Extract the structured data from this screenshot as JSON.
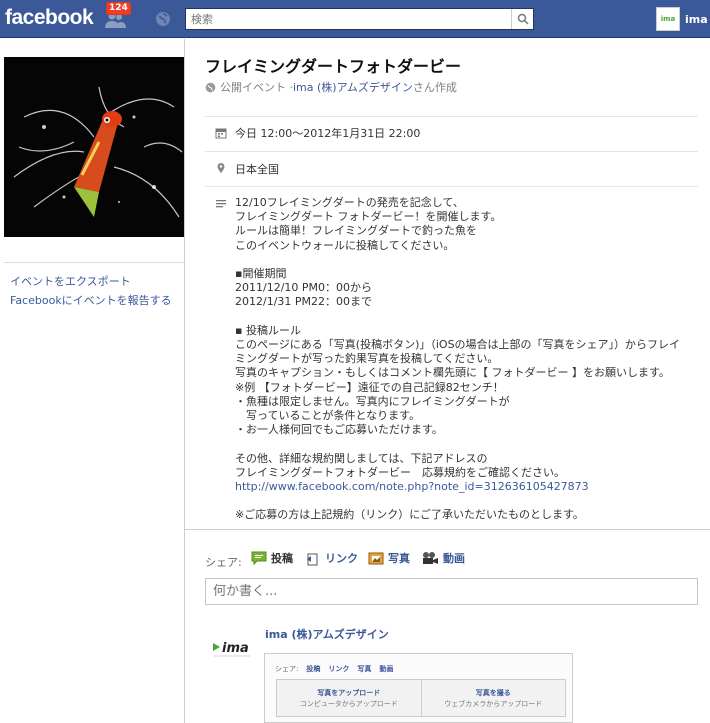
{
  "header": {
    "logo": "facebook",
    "notification_count": "124",
    "search_placeholder": "検索",
    "user_name": "ima",
    "user_avatar_text": "ima"
  },
  "sidebar": {
    "links": [
      "イベントをエクスポート",
      "Facebookにイベントを報告する"
    ]
  },
  "event": {
    "title": "フレイミングダートフォトダービー",
    "visibility": "公開イベント · ",
    "creator": "ima (株)アムズデザイン",
    "creator_suffix": "さん作成",
    "datetime": "今日 12:00～2012年1月31日 22:00",
    "location": "日本全国",
    "description_lines": [
      "12/10フレイミングダートの発売を記念して、",
      "フレイミングダート フォトダービー！を開催します。",
      "ルールは簡単！フレイミングダートで釣った魚を",
      "このイベントウォールに投稿してください。",
      "",
      "▪開催期間",
      "2011/12/10 PM0：00から",
      "2012/1/31 PM22：00まで",
      "",
      "▪ 投稿ルール",
      "このページにある「写真(投稿ボタン)」（iOSの場合は上部の「写真をシェア」）からフレイ",
      "ミングダートが写った釣果写真を投稿してください。",
      "写真のキャプション・もしくはコメント欄先頭に【 フォトダービー 】をお願いします。",
      "※例 【フォトダービー】遠征での自己記録82センチ！",
      "・魚種は限定しません。写真内にフレイミングダートが",
      "　写っていることが条件となります。",
      "・お一人様何回でもご応募いただけます。",
      "",
      "その他、詳細な規約関しましては、下記アドレスの",
      "フレイミングダートフォトダービー　応募規約をご確認ください。"
    ],
    "description_link": "http://www.facebook.com/note.php?note_id=312636105427873",
    "description_footer": "※ご応募の方は上記規約（リンク）にご了承いただいたものとします。"
  },
  "share": {
    "label": "シェア:",
    "items": [
      "投稿",
      "リンク",
      "写真",
      "動画"
    ],
    "composer_placeholder": "何か書く..."
  },
  "post": {
    "author": "ima (株)アムズデザイン",
    "avatar_text": "ima",
    "thumb_share_label": "シェア:",
    "thumb_items": [
      "投稿",
      "リンク",
      "写真",
      "動画"
    ],
    "upload_title": "写真をアップロード",
    "upload_sub": "コンピュータからアップロード",
    "camera_title": "写真を撮る",
    "camera_sub": "ウェブカメラからアップロード"
  },
  "colors": {
    "brand": "#3b5998",
    "badge": "#f03d25",
    "link": "#3b5998"
  }
}
